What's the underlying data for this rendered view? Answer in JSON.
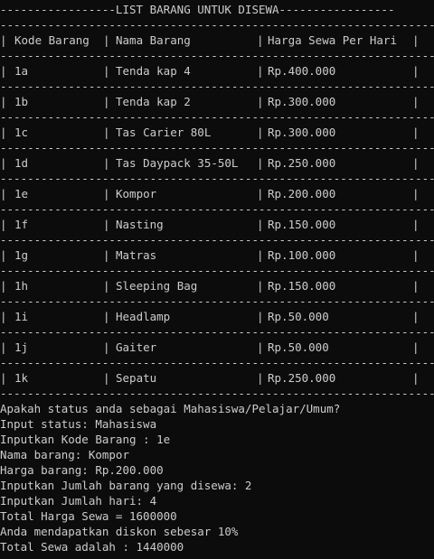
{
  "title_line": "-----------------LIST BARANG UNTUK DISEWA-----------------",
  "separator": "--------------------------------------------------------------------",
  "table": {
    "headers": [
      "Kode Barang",
      "Nama Barang",
      "Harga Sewa Per Hari"
    ],
    "rows": [
      [
        "1a",
        "Tenda kap 4",
        "Rp.400.000"
      ],
      [
        "1b",
        "Tenda kap 2",
        "Rp.300.000"
      ],
      [
        "1c",
        "Tas Carier 80L",
        "Rp.300.000"
      ],
      [
        "1d",
        "Tas Daypack 35-50L",
        "Rp.250.000"
      ],
      [
        "1e",
        "Kompor",
        "Rp.200.000"
      ],
      [
        "1f",
        "Nasting",
        "Rp.150.000"
      ],
      [
        "1g",
        "Matras",
        "Rp.100.000"
      ],
      [
        "1h",
        "Sleeping Bag",
        "Rp.150.000"
      ],
      [
        "1i",
        "Headlamp",
        "Rp.50.000"
      ],
      [
        "1j",
        "Gaiter",
        "Rp.50.000"
      ],
      [
        "1k",
        "Sepatu",
        "Rp.250.000"
      ]
    ]
  },
  "output": [
    "Apakah status anda sebagai Mahasiswa/Pelajar/Umum?",
    "Input status: Mahasiswa",
    "Inputkan Kode Barang : 1e",
    "Nama barang: Kompor",
    "Harga barang: Rp.200.000",
    "Inputkan Jumlah barang yang disewa: 2",
    "Inputkan Jumlah hari: 4",
    "Total Harga Sewa = 1600000",
    "Anda mendapatkan diskon sebesar 10%",
    "Total Sewa adalah : 1440000"
  ]
}
